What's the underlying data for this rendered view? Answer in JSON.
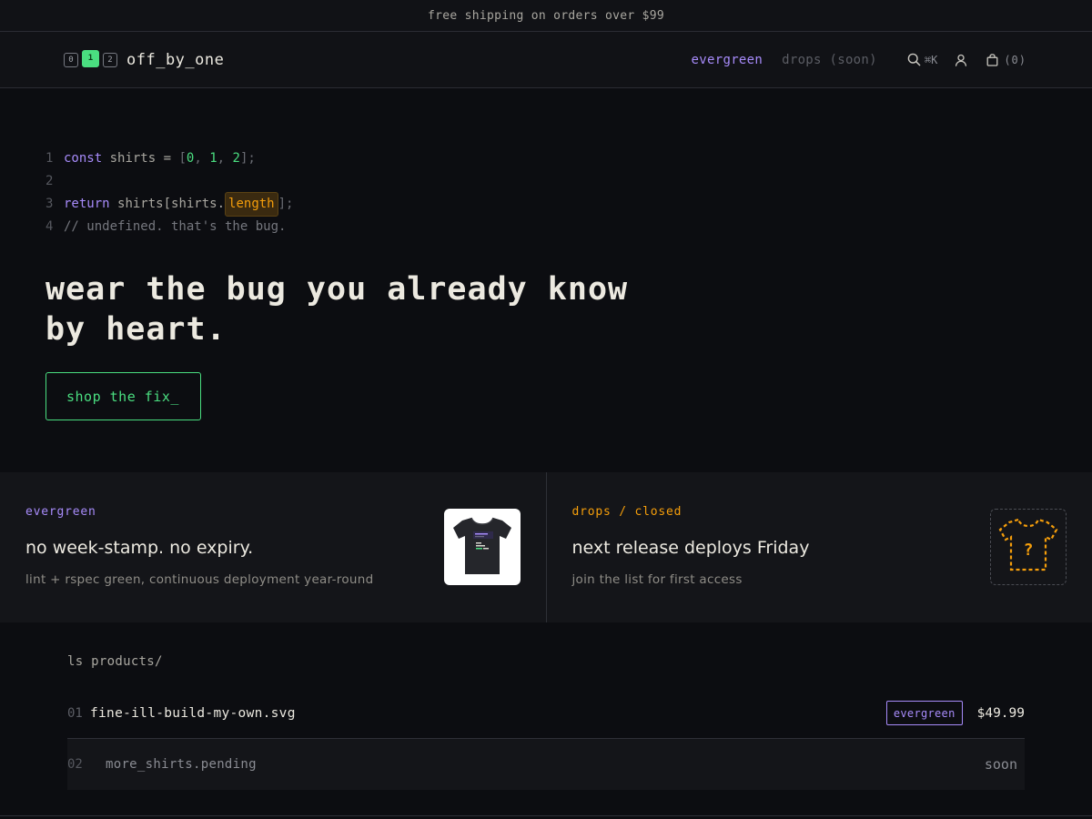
{
  "announcement": "free shipping on orders over $99",
  "header": {
    "logo_digits": [
      "0",
      "1",
      "2"
    ],
    "brand": "off_by_one",
    "nav": {
      "evergreen": "evergreen",
      "drops": "drops (soon)"
    },
    "search_shortcut": "⌘K",
    "cart_count": "(0)"
  },
  "hero": {
    "code_lines": [
      {
        "num": "1"
      },
      {
        "num": "2"
      },
      {
        "num": "3"
      },
      {
        "num": "4"
      }
    ],
    "line1": {
      "kw": "const",
      "ident": "shirts",
      "eq": " = ",
      "open": "[",
      "n0": "0",
      "comma1": ", ",
      "n1": "1",
      "comma2": ", ",
      "n2": "2",
      "close": "];"
    },
    "line3": {
      "kw": "return",
      "expr": "shirts[shirts.",
      "hl": "length",
      "close": "];"
    },
    "line4": "// undefined. that's the bug.",
    "headline": "wear the bug you already know by heart.",
    "cta": "shop the fix_"
  },
  "features": [
    {
      "tag": "evergreen",
      "title": "no week-stamp. no expiry.",
      "subtitle": "lint + rspec green, continuous deployment year-round"
    },
    {
      "tag": "drops / closed",
      "title": "next release deploys Friday",
      "subtitle": "join the list for first access"
    }
  ],
  "products": {
    "heading": "ls products/",
    "items": [
      {
        "index": "01",
        "name": "fine-ill-build-my-own.svg",
        "badge": "evergreen",
        "price": "$49.99"
      },
      {
        "index": "02",
        "name": "more_shirts.pending",
        "status": "soon"
      }
    ]
  },
  "colors": {
    "background": "#0c0d11",
    "accent_green": "#4ade80",
    "accent_purple": "#a78bfa",
    "accent_orange": "#f59e0b"
  },
  "icons": [
    "search-icon",
    "user-icon",
    "bag-icon",
    "tshirt-icon",
    "tshirt-placeholder-icon"
  ]
}
